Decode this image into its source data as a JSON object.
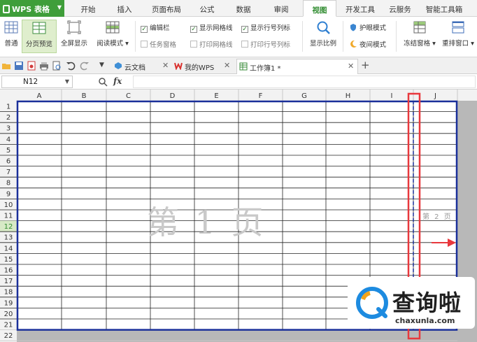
{
  "app": {
    "logo": "WPS 表格",
    "menu_tabs": [
      "开始",
      "插入",
      "页面布局",
      "公式",
      "数据",
      "审阅",
      "视图",
      "开发工具",
      "云服务",
      "智能工具箱"
    ],
    "active_tab": "视图"
  },
  "ribbon": {
    "normal": "普通",
    "page_break_preview": "分页预览",
    "full_screen": "全屏显示",
    "reading_mode": "阅读模式",
    "checks": {
      "edit_bar": "编辑栏",
      "task_pane": "任务窗格",
      "show_gridlines": "显示网格线",
      "print_gridlines": "打印网格线",
      "show_row_col_headers": "显示行号列标",
      "print_row_col_headers": "打印行号列标"
    },
    "zoom": "显示比例",
    "eye_protection": "护眼模式",
    "night_mode": "夜间模式",
    "freeze_panes": "冻结窗格",
    "rearrange_windows": "重排窗口"
  },
  "doc_tabs": {
    "cloud_docs": "云文档",
    "my_wps": "我的WPS",
    "workbook": "工作簿1 *"
  },
  "formula_bar": {
    "name_box": "N12",
    "fx": "fx",
    "value": ""
  },
  "sheet": {
    "columns": [
      "A",
      "B",
      "C",
      "D",
      "E",
      "F",
      "G",
      "H",
      "I",
      "J"
    ],
    "rows": [
      "1",
      "2",
      "3",
      "4",
      "5",
      "6",
      "7",
      "8",
      "9",
      "10",
      "11",
      "12",
      "13",
      "14",
      "15",
      "16",
      "17",
      "18",
      "19",
      "20",
      "21",
      "22"
    ],
    "active_row": "12",
    "page1_watermark": "第 1 页",
    "page2_watermark": "第 2 页",
    "page_border_color": "#1a2f9a",
    "highlight_color": "#e8383d"
  },
  "badge": {
    "title": "查询啦",
    "url": "chaxunla.com"
  }
}
